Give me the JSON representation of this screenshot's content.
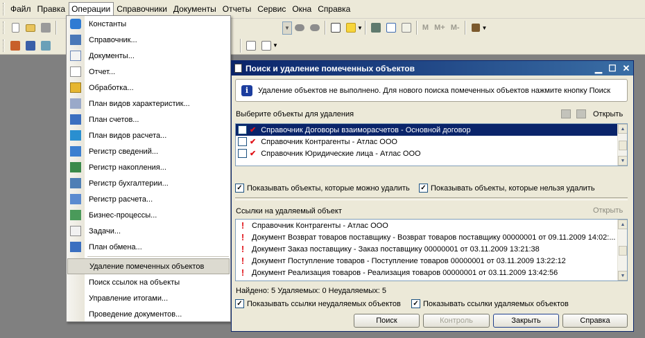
{
  "menubar": [
    "Файл",
    "Правка",
    "Операции",
    "Справочники",
    "Документы",
    "Отчеты",
    "Сервис",
    "Окна",
    "Справка"
  ],
  "colors": {
    "title_start": "#0a246a",
    "title_end": "#3a6ea5",
    "mark_red": "#e0141a"
  },
  "toolbar": {
    "m_buttons": [
      "M",
      "M+",
      "M-"
    ]
  },
  "operations_menu": {
    "items": [
      "Константы",
      "Справочник...",
      "Документы...",
      "Отчет...",
      "Обработка...",
      "План видов характеристик...",
      "План счетов...",
      "План видов расчета...",
      "Регистр сведений...",
      "Регистр накопления...",
      "Регистр бухгалтерии...",
      "Регистр расчета...",
      "Бизнес-процессы...",
      "Задачи...",
      "План обмена...",
      "Удаление помеченных объектов",
      "Поиск ссылок на объекты",
      "Управление итогами...",
      "Проведение документов..."
    ],
    "highlighted": "Удаление помеченных объектов"
  },
  "dialog": {
    "title": "Поиск и удаление помеченных объектов",
    "info": "Удаление объектов не выполнено. Для нового поиска помеченных объектов нажмите кнопку Поиск",
    "select_label": "Выберите объекты для удаления",
    "open_link": "Открыть",
    "objects": [
      {
        "text": "Справочник Договоры взаиморасчетов - Основной договор",
        "checked": false,
        "selected": true
      },
      {
        "text": "Справочник Контрагенты - Атлас ООО",
        "checked": false,
        "selected": false
      },
      {
        "text": "Справочник Юридические лица - Атлас ООО",
        "checked": false,
        "selected": false
      }
    ],
    "cb_deletable": "Показывать объекты, которые можно удалить",
    "cb_not_deletable": "Показывать объекты, которые нельзя удалить",
    "refs_label": "Ссылки на удаляемый объект",
    "refs_open": "Открыть",
    "refs": [
      "Справочник Контрагенты - Атлас ООО",
      "Документ Возврат товаров поставщику - Возврат товаров поставщику 00000001 от 09.11.2009 14:02:...",
      "Документ Заказ поставщику - Заказ поставщику 00000001 от 03.11.2009 13:21:38",
      "Документ Поступление товаров - Поступление товаров 00000001 от 03.11.2009 13:22:12",
      "Документ Реализация товаров - Реализация товаров 00000001 от 03.11.2009 13:42:56"
    ],
    "status": "Найдено: 5  Удаляемых: 0  Неудаляемых: 5",
    "cb_refs_not_deletable": "Показывать ссылки неудаляемых объектов",
    "cb_refs_deletable": "Показывать ссылки удаляемых объектов",
    "buttons": {
      "search": "Поиск",
      "control": "Контроль",
      "close": "Закрыть",
      "help": "Справка"
    }
  }
}
